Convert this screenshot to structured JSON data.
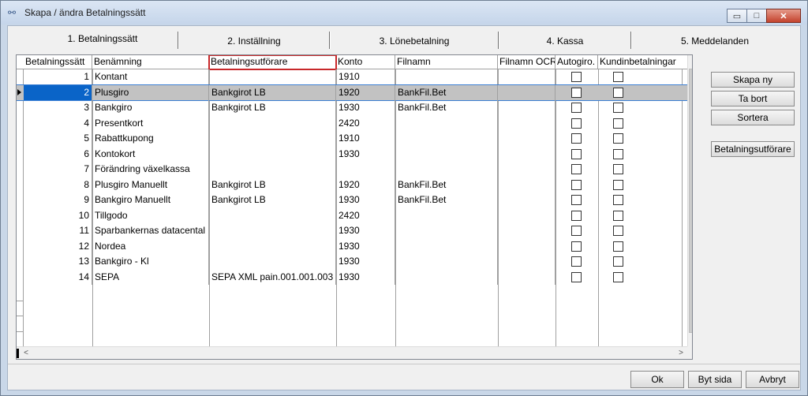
{
  "window": {
    "title": "Skapa / ändra Betalningssätt",
    "minimize": "▭",
    "maximize": "□",
    "close": "✕"
  },
  "tabs": [
    {
      "label": "1. Betalningssätt"
    },
    {
      "label": "2. Inställning"
    },
    {
      "label": "3. Lönebetalning"
    },
    {
      "label": "4. Kassa"
    },
    {
      "label": "5. Meddelanden"
    }
  ],
  "grid": {
    "columns": [
      "Betalningssätt",
      "Benämning",
      "Betalningsutförare",
      "Konto",
      "Filnamn",
      "Filnamn OCR",
      "Autogiro.",
      "Kundinbetalningar"
    ],
    "rows": [
      {
        "id": "1",
        "name": "Kontant",
        "executor": "",
        "account": "1910",
        "filename": "",
        "autogiro": false,
        "kund": false
      },
      {
        "id": "2",
        "name": "Plusgiro",
        "executor": "Bankgirot LB",
        "account": "1920",
        "filename": "BankFil.Bet",
        "autogiro": false,
        "kund": false
      },
      {
        "id": "3",
        "name": "Bankgiro",
        "executor": "Bankgirot LB",
        "account": "1930",
        "filename": "BankFil.Bet",
        "autogiro": false,
        "kund": false
      },
      {
        "id": "4",
        "name": "Presentkort",
        "executor": "",
        "account": "2420",
        "filename": "",
        "autogiro": false,
        "kund": false
      },
      {
        "id": "5",
        "name": "Rabattkupong",
        "executor": "",
        "account": "1910",
        "filename": "",
        "autogiro": false,
        "kund": false
      },
      {
        "id": "6",
        "name": "Kontokort",
        "executor": "",
        "account": "1930",
        "filename": "",
        "autogiro": false,
        "kund": false
      },
      {
        "id": "7",
        "name": "Förändring växelkassa",
        "executor": "",
        "account": "",
        "filename": "",
        "autogiro": false,
        "kund": false
      },
      {
        "id": "8",
        "name": "Plusgiro Manuellt",
        "executor": "Bankgirot LB",
        "account": "1920",
        "filename": "BankFil.Bet",
        "autogiro": false,
        "kund": false
      },
      {
        "id": "9",
        "name": "Bankgiro Manuellt",
        "executor": "Bankgirot LB",
        "account": "1930",
        "filename": "BankFil.Bet",
        "autogiro": false,
        "kund": false
      },
      {
        "id": "10",
        "name": "Tillgodo",
        "executor": "",
        "account": "2420",
        "filename": "",
        "autogiro": false,
        "kund": false
      },
      {
        "id": "11",
        "name": "Sparbankernas datacental",
        "executor": "",
        "account": "1930",
        "filename": "",
        "autogiro": false,
        "kund": false
      },
      {
        "id": "12",
        "name": "Nordea",
        "executor": "",
        "account": "1930",
        "filename": "",
        "autogiro": false,
        "kund": false
      },
      {
        "id": "13",
        "name": "Bankgiro - Kl",
        "executor": "",
        "account": "1930",
        "filename": "",
        "autogiro": false,
        "kund": false
      },
      {
        "id": "14",
        "name": "SEPA",
        "executor": "SEPA XML pain.001.001.003",
        "account": "1930",
        "filename": "",
        "autogiro": false,
        "kund": false
      }
    ]
  },
  "side_buttons": {
    "create": "Skapa ny",
    "delete": "Ta bort",
    "sort": "Sortera",
    "executor": "Betalningsutförare"
  },
  "bottom_buttons": {
    "ok": "Ok",
    "switch": "Byt sida",
    "cancel": "Avbryt"
  }
}
